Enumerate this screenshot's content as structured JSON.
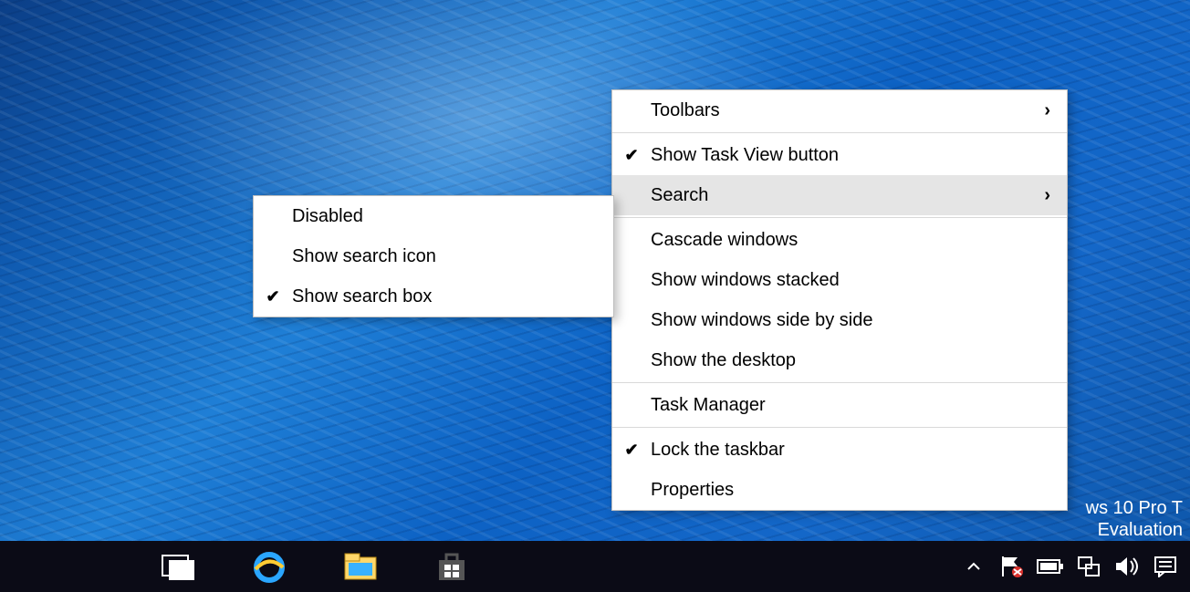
{
  "watermark": {
    "line1": "ws 10 Pro T",
    "line2": "Evaluation"
  },
  "context_menu": {
    "toolbars": "Toolbars",
    "show_task_view": "Show Task View button",
    "search": "Search",
    "cascade": "Cascade windows",
    "stacked": "Show windows stacked",
    "side_by_side": "Show windows side by side",
    "show_desktop": "Show the desktop",
    "task_manager": "Task Manager",
    "lock_taskbar": "Lock the taskbar",
    "properties": "Properties"
  },
  "search_submenu": {
    "disabled": "Disabled",
    "show_icon": "Show search icon",
    "show_box": "Show search box"
  },
  "checkmark": "✔",
  "submenu_arrow": "›"
}
